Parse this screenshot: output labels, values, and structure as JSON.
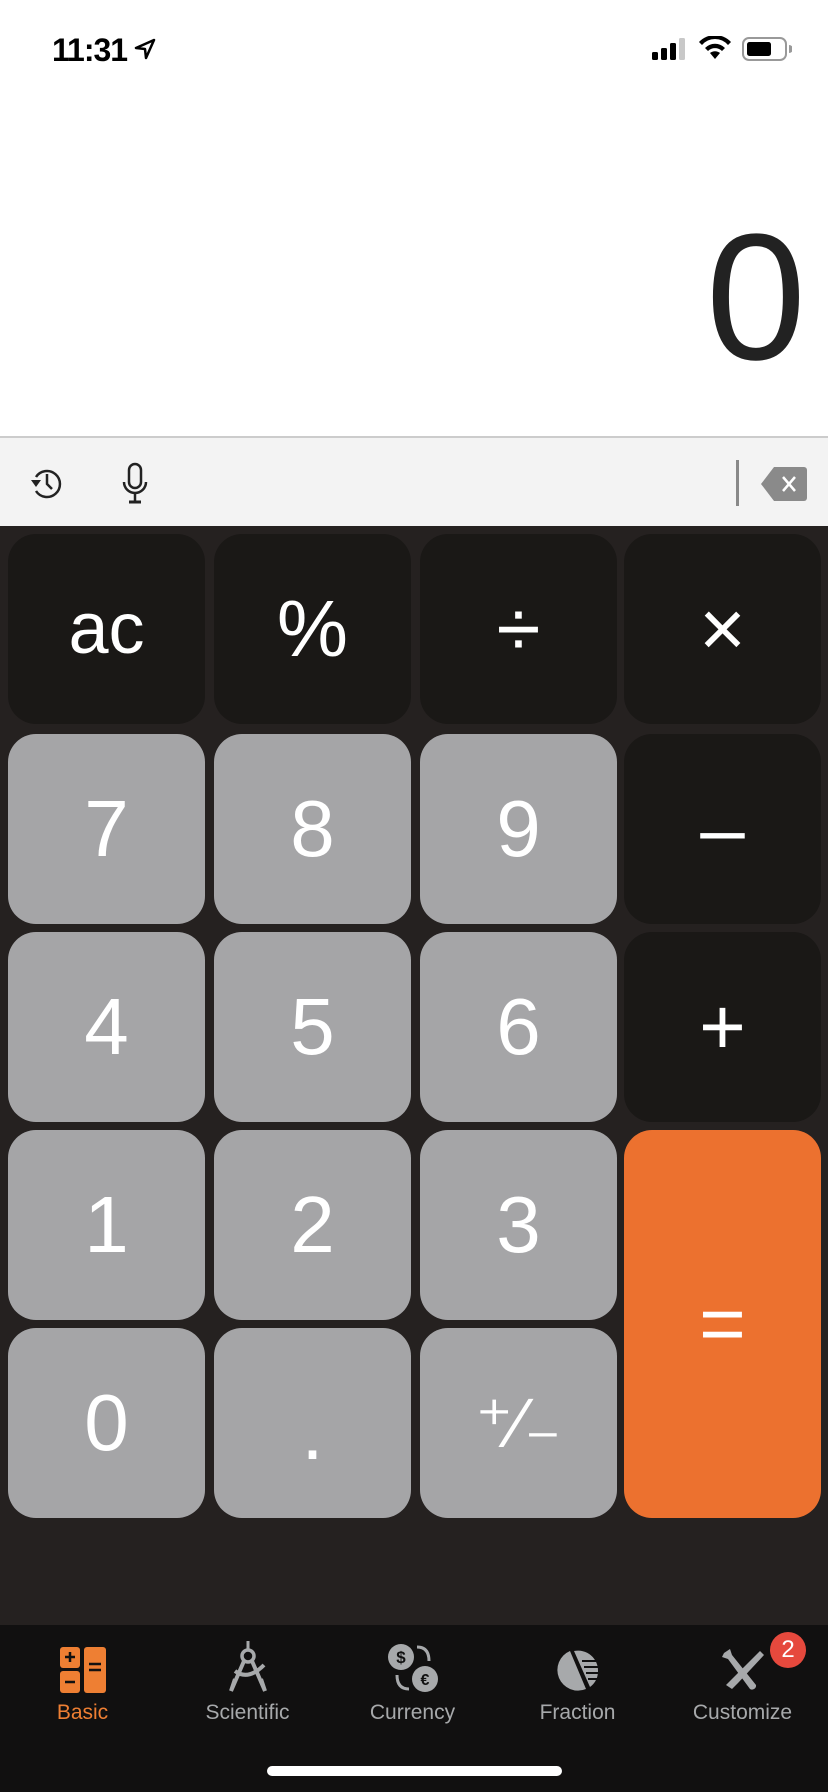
{
  "status_bar": {
    "time": "11:31",
    "location_icon": "location-arrow-icon",
    "signal_icon": "cellular-signal-icon",
    "wifi_icon": "wifi-icon",
    "battery_icon": "battery-icon"
  },
  "display": {
    "value": "0"
  },
  "toolbar": {
    "history_icon": "history-icon",
    "mic_icon": "microphone-icon",
    "delete_icon": "backspace-icon"
  },
  "keys": [
    {
      "label": "ac",
      "name": "all-clear-key",
      "style": "dark"
    },
    {
      "label": "%",
      "name": "percent-key",
      "style": "dark"
    },
    {
      "label": "÷",
      "name": "divide-key",
      "style": "dark"
    },
    {
      "label": "×",
      "name": "multiply-key",
      "style": "dark"
    },
    {
      "label": "7",
      "name": "key-7",
      "style": "gray"
    },
    {
      "label": "8",
      "name": "key-8",
      "style": "gray"
    },
    {
      "label": "9",
      "name": "key-9",
      "style": "gray"
    },
    {
      "label": "–",
      "name": "subtract-key",
      "style": "dark"
    },
    {
      "label": "4",
      "name": "key-4",
      "style": "gray"
    },
    {
      "label": "5",
      "name": "key-5",
      "style": "gray"
    },
    {
      "label": "6",
      "name": "key-6",
      "style": "gray"
    },
    {
      "label": "+",
      "name": "add-key",
      "style": "dark"
    },
    {
      "label": "1",
      "name": "key-1",
      "style": "gray"
    },
    {
      "label": "2",
      "name": "key-2",
      "style": "gray"
    },
    {
      "label": "3",
      "name": "key-3",
      "style": "gray"
    },
    {
      "label": "=",
      "name": "equals-key",
      "style": "orange"
    },
    {
      "label": "0",
      "name": "key-0",
      "style": "gray"
    },
    {
      "label": ".",
      "name": "decimal-key",
      "style": "gray"
    },
    {
      "label": "⁺∕₋",
      "name": "plus-minus-key",
      "style": "gray"
    }
  ],
  "tabs": [
    {
      "label": "Basic",
      "icon": "basic-calculator-icon",
      "active": true
    },
    {
      "label": "Scientific",
      "icon": "compass-icon",
      "active": false
    },
    {
      "label": "Currency",
      "icon": "currency-exchange-icon",
      "active": false
    },
    {
      "label": "Fraction",
      "icon": "pie-chart-icon",
      "active": false
    },
    {
      "label": "Customize",
      "icon": "tools-icon",
      "active": false
    }
  ],
  "customize_badge": "2",
  "colors": {
    "accent": "#ec712f",
    "badge": "#e6493d",
    "key_gray": "#a5a5a7",
    "key_dark": "#1a1816"
  }
}
